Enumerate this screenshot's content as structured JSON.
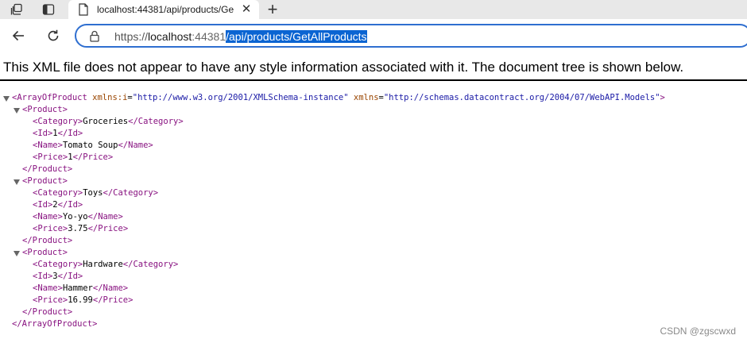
{
  "tab": {
    "title": "localhost:44381/api/products/Ge",
    "close_glyph": "✕"
  },
  "new_tab_glyph": "+",
  "icons": {
    "workspaces": "workspaces-icon",
    "tab_actions": "tab-actions-icon",
    "page": "page-icon",
    "back": "back-arrow-icon",
    "refresh": "refresh-icon",
    "lock": "lock-icon"
  },
  "address": {
    "scheme": "https://",
    "host": "localhost",
    "port": ":44381",
    "path": "/api/products/GetAllProducts"
  },
  "notice": "This XML file does not appear to have any style information associated with it. The document tree is shown below.",
  "xml": {
    "root_open": "<ArrayOfProduct",
    "attr1_name": "xmlns:i",
    "attr1_value": "\"http://www.w3.org/2001/XMLSchema-instance\"",
    "attr2_name": "xmlns",
    "attr2_value": "\"http://schemas.datacontract.org/2004/07/WebAPI.Models\"",
    "root_open_end": ">",
    "root_close": "</ArrayOfProduct>",
    "product_open": "<Product>",
    "product_close": "</Product>",
    "products": [
      {
        "category_open": "<Category>",
        "category": "Groceries",
        "category_close": "</Category>",
        "id_open": "<Id>",
        "id": "1",
        "id_close": "</Id>",
        "name_open": "<Name>",
        "name": "Tomato Soup",
        "name_close": "</Name>",
        "price_open": "<Price>",
        "price": "1",
        "price_close": "</Price>"
      },
      {
        "category_open": "<Category>",
        "category": "Toys",
        "category_close": "</Category>",
        "id_open": "<Id>",
        "id": "2",
        "id_close": "</Id>",
        "name_open": "<Name>",
        "name": "Yo-yo",
        "name_close": "</Name>",
        "price_open": "<Price>",
        "price": "3.75",
        "price_close": "</Price>"
      },
      {
        "category_open": "<Category>",
        "category": "Hardware",
        "category_close": "</Category>",
        "id_open": "<Id>",
        "id": "3",
        "id_close": "</Id>",
        "name_open": "<Name>",
        "name": "Hammer",
        "name_close": "</Name>",
        "price_open": "<Price>",
        "price": "16.99",
        "price_close": "</Price>"
      }
    ]
  },
  "watermark": "CSDN @zgscwxd",
  "colors": {
    "tag": "#881280",
    "attribute_name": "#994500",
    "attribute_value": "#1a1aa6",
    "selection": "#0a64d2",
    "omnibox_border": "#2f6fd0"
  }
}
